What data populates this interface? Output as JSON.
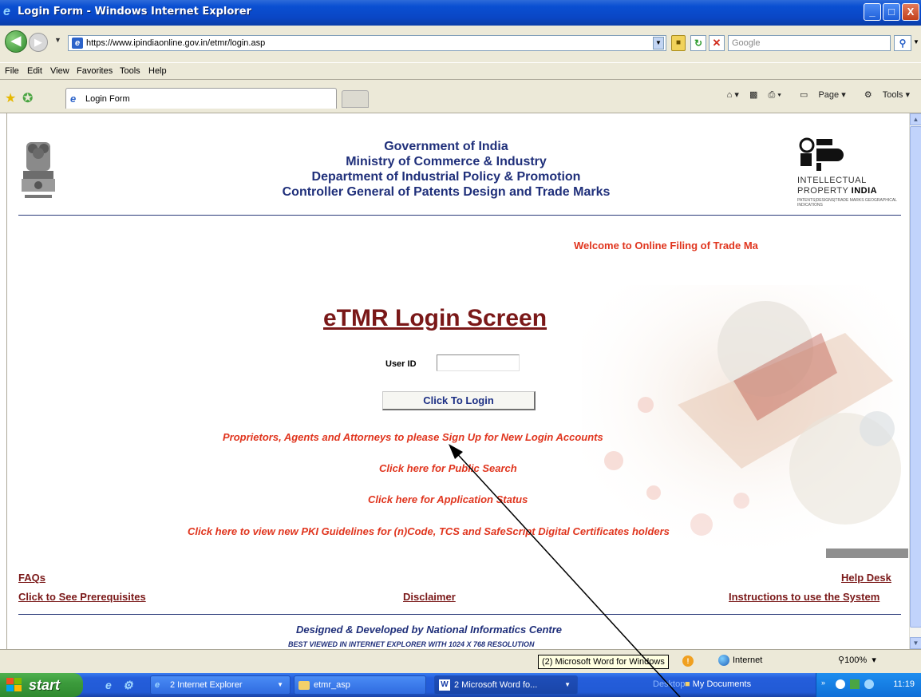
{
  "window": {
    "title": "Login Form - Windows Internet Explorer",
    "buttons": {
      "minimize": "_",
      "maximize": "□",
      "close": "X"
    }
  },
  "addressbar": {
    "url": "https://www.ipindiaonline.gov.in/etmr/login.asp",
    "search_placeholder": "Google"
  },
  "menubar": {
    "items": [
      "File",
      "Edit",
      "View",
      "Favorites",
      "Tools",
      "Help"
    ]
  },
  "tabs": [
    {
      "label": "Login Form"
    }
  ],
  "commandbar": {
    "page_label": "Page",
    "tools_label": "Tools"
  },
  "page": {
    "header": {
      "line1": "Government of India",
      "line2": "Ministry of Commerce & Industry",
      "line3": "Department of Industrial Policy & Promotion",
      "line4": "Controller General of Patents Design and Trade Marks"
    },
    "logo": {
      "line1": "INTELLECTUAL",
      "line2_a": "PROPERTY ",
      "line2_b": "INDIA",
      "line3": "PATENTS|DESIGNS|TRADE MARKS GEOGRAPHICAL INDICATIONS"
    },
    "welcome": "Welcome to Online Filing of Trade Ma",
    "login_title": "eTMR Login Screen",
    "userid_label": "User ID",
    "userid_value": "",
    "login_button": "Click To Login",
    "links": {
      "signup": "Proprietors, Agents and Attorneys to please Sign Up for New Login Accounts",
      "public_search": "Click here for Public Search",
      "app_status": "Click here for Application Status",
      "pki": "Click here to view new PKI Guidelines for (n)Code, TCS and SafeScript Digital Certificates holders"
    },
    "footer": {
      "faqs": "FAQs",
      "prerequisites": "Click to See Prerequisites",
      "disclaimer": "Disclaimer",
      "help_desk": "Help Desk",
      "instructions": "Instructions to use the System",
      "designed_by": "Designed & Developed by National Informatics Centre",
      "best_viewed": "BEST VIEWED IN INTERNET EXPLORER WITH 1024 X 768 RESOLUTION"
    }
  },
  "statusbar": {
    "tooltip": "(2) Microsoft Word for Windows",
    "zone": "Internet",
    "zoom": "100%"
  },
  "taskbar": {
    "start": "start",
    "items": [
      {
        "label": "2 Internet Explorer"
      },
      {
        "label": "etmr_asp"
      },
      {
        "label": "2 Microsoft Word fo..."
      }
    ],
    "desktop": "Desktop",
    "my_documents": "My Documents",
    "time": "11:19"
  }
}
